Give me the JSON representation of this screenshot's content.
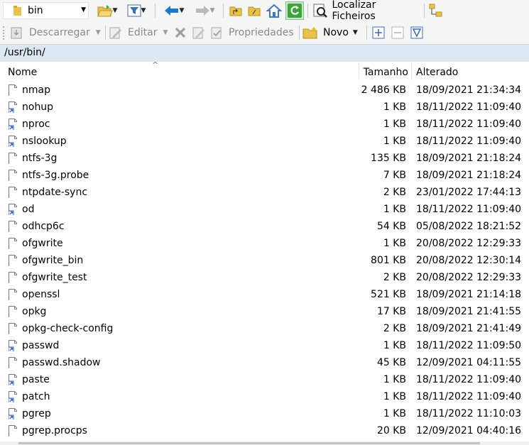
{
  "toolbar_top": {
    "location_combo": {
      "value": "bin",
      "icon": "folder-icon"
    },
    "find_files_label": "Localizar Ficheiros",
    "colors": {
      "back_arrow": "#1e78d2",
      "refresh_green": "#3aa63a",
      "home": "#3c78c8",
      "folder": "#e8c24a"
    }
  },
  "toolbar_bottom": {
    "download_label": "Descarregar",
    "edit_label": "Editar",
    "properties_label": "Propriedades",
    "new_label": "Novo"
  },
  "path": "/usr/bin/",
  "columns": {
    "name": "Nome",
    "size": "Tamanho",
    "modified": "Alterado"
  },
  "files": [
    {
      "name": "nmap",
      "size": "2 486 KB",
      "modified": "18/09/2021 21:34:34",
      "link": false
    },
    {
      "name": "nohup",
      "size": "1 KB",
      "modified": "18/11/2022 11:09:40",
      "link": true
    },
    {
      "name": "nproc",
      "size": "1 KB",
      "modified": "18/11/2022 11:09:40",
      "link": true
    },
    {
      "name": "nslookup",
      "size": "1 KB",
      "modified": "18/11/2022 11:09:40",
      "link": true
    },
    {
      "name": "ntfs-3g",
      "size": "135 KB",
      "modified": "18/09/2021 21:18:24",
      "link": false
    },
    {
      "name": "ntfs-3g.probe",
      "size": "7 KB",
      "modified": "18/09/2021 21:18:24",
      "link": false
    },
    {
      "name": "ntpdate-sync",
      "size": "2 KB",
      "modified": "23/01/2022 17:44:13",
      "link": false
    },
    {
      "name": "od",
      "size": "1 KB",
      "modified": "18/11/2022 11:09:40",
      "link": true
    },
    {
      "name": "odhcp6c",
      "size": "54 KB",
      "modified": "05/08/2022 18:21:52",
      "link": false
    },
    {
      "name": "ofgwrite",
      "size": "1 KB",
      "modified": "20/08/2022 12:29:33",
      "link": false
    },
    {
      "name": "ofgwrite_bin",
      "size": "801 KB",
      "modified": "20/08/2022 12:30:14",
      "link": false
    },
    {
      "name": "ofgwrite_test",
      "size": "2 KB",
      "modified": "20/08/2022 12:29:33",
      "link": false
    },
    {
      "name": "openssl",
      "size": "521 KB",
      "modified": "18/09/2021 21:14:18",
      "link": false
    },
    {
      "name": "opkg",
      "size": "17 KB",
      "modified": "18/09/2021 21:41:55",
      "link": false
    },
    {
      "name": "opkg-check-config",
      "size": "2 KB",
      "modified": "18/09/2021 21:41:49",
      "link": false
    },
    {
      "name": "passwd",
      "size": "1 KB",
      "modified": "18/11/2022 11:09:50",
      "link": true
    },
    {
      "name": "passwd.shadow",
      "size": "45 KB",
      "modified": "12/09/2021 04:11:55",
      "link": false
    },
    {
      "name": "paste",
      "size": "1 KB",
      "modified": "18/11/2022 11:09:40",
      "link": true
    },
    {
      "name": "patch",
      "size": "1 KB",
      "modified": "18/11/2022 11:09:40",
      "link": true
    },
    {
      "name": "pgrep",
      "size": "1 KB",
      "modified": "18/11/2022 11:10:03",
      "link": true
    },
    {
      "name": "pgrep.procps",
      "size": "20 KB",
      "modified": "12/09/2021 04:40:16",
      "link": false
    }
  ]
}
